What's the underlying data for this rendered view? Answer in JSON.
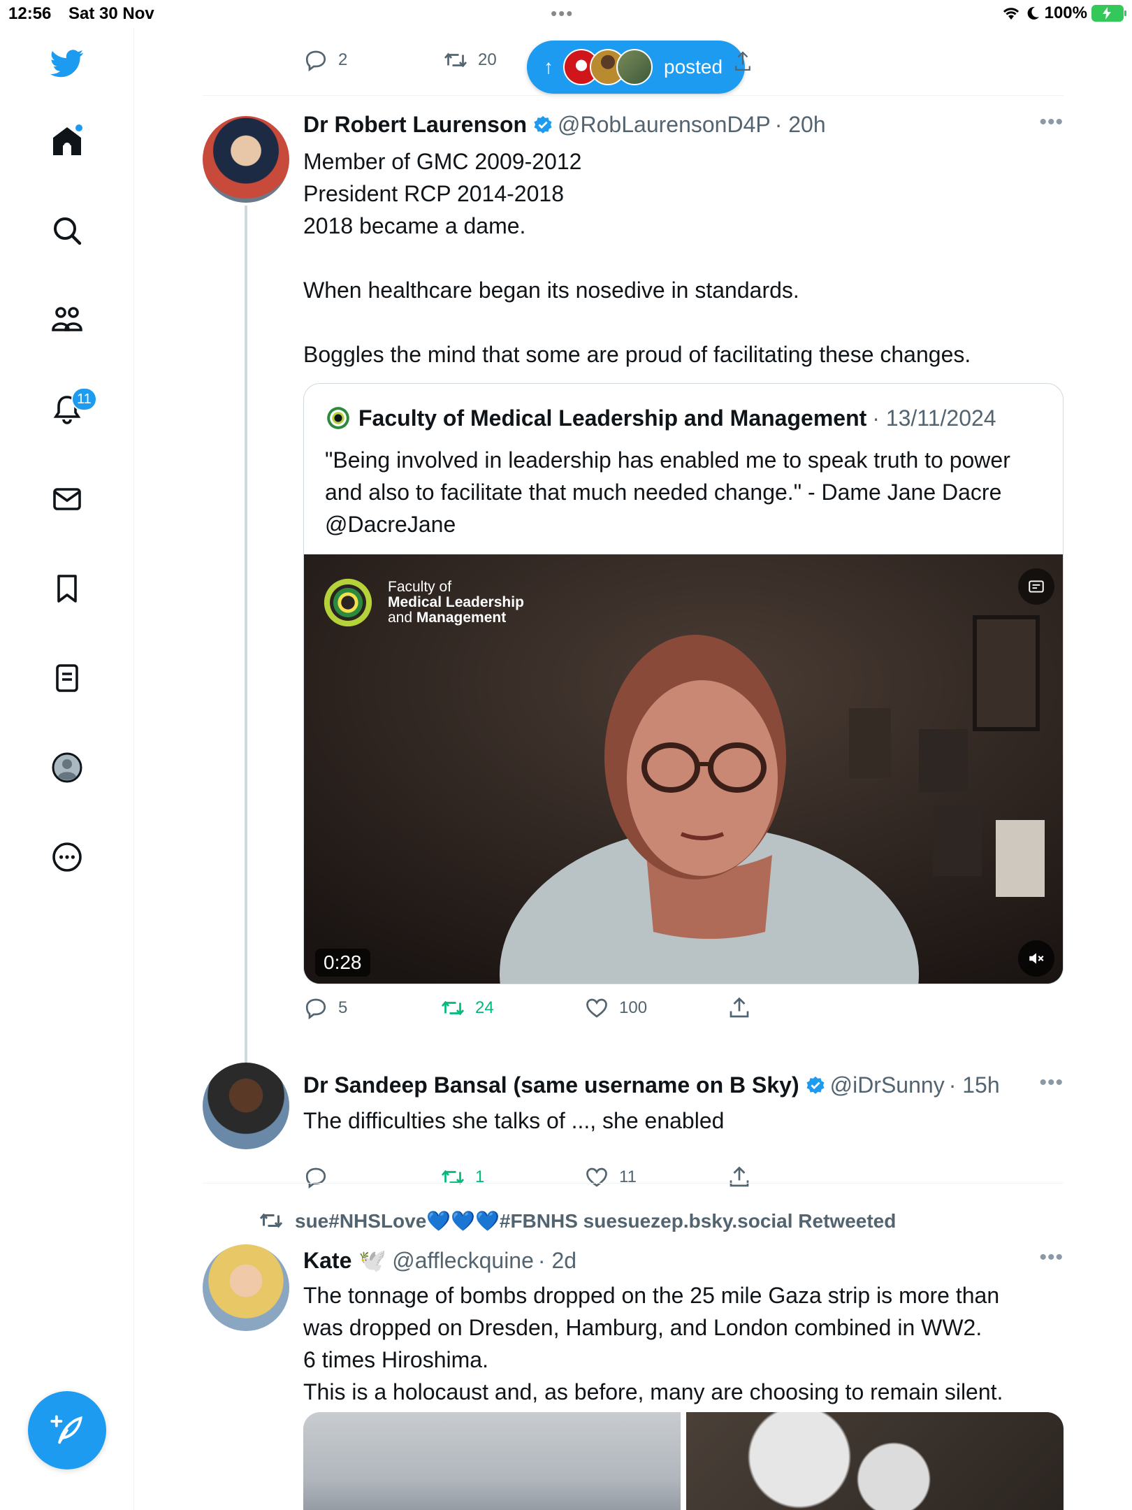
{
  "status_bar": {
    "time": "12:56",
    "date": "Sat 30 Nov",
    "battery": "100%"
  },
  "sidebar": {
    "notifications_badge": "11",
    "items": [
      "twitter-logo",
      "home",
      "search",
      "communities",
      "notifications",
      "messages",
      "bookmarks",
      "lists",
      "profile",
      "more"
    ]
  },
  "prev_tweet": {
    "replies": "2",
    "retweets": "20"
  },
  "new_posts_pill": {
    "label": "posted"
  },
  "tweet1": {
    "name": "Dr Robert Laurenson",
    "handle": "@RobLaurensonD4P",
    "time": "· 20h",
    "text": "Member of GMC 2009-2012\nPresident RCP 2014-2018\n2018 became a dame.\n\nWhen healthcare began its nosedive in standards.\n\nBoggles the mind that some are proud of facilitating these changes.",
    "quote": {
      "name": "Faculty of Medical Leadership and Management",
      "date": "· 13/11/2024",
      "text": "\"Being involved in leadership has enabled me to speak truth to power and also to facilitate that much needed change.\" - Dame Jane Dacre @DacreJane",
      "video_logo_line1": "Faculty of",
      "video_logo_line2": "Medical Leadership",
      "video_logo_line3a": "and ",
      "video_logo_line3b": "Management",
      "duration": "0:28"
    },
    "replies": "5",
    "retweets": "24",
    "likes": "100"
  },
  "tweet2": {
    "name": "Dr Sandeep Bansal (same username on B Sky)",
    "handle": "@iDrSunny",
    "time": "· 15h",
    "text": "The difficulties she talks of ..., she enabled",
    "replies": "",
    "retweets": "1",
    "likes": "11"
  },
  "tweet3": {
    "retweeted_by": "sue#NHSLove💙💙💙#FBNHS suesuezep.bsky.social Retweeted",
    "name": "Kate",
    "emoji": "🕊️",
    "handle": "@affleckquine",
    "time": "· 2d",
    "text": "The tonnage of bombs dropped on the 25 mile Gaza strip is more than was dropped on Dresden, Hamburg, and London combined in WW2.\n6 times Hiroshima.\nThis is a holocaust and, as before, many are choosing to remain silent."
  },
  "colors": {
    "accent": "#1d9bf0",
    "retweet": "#00ba7c",
    "muted": "#536471"
  }
}
